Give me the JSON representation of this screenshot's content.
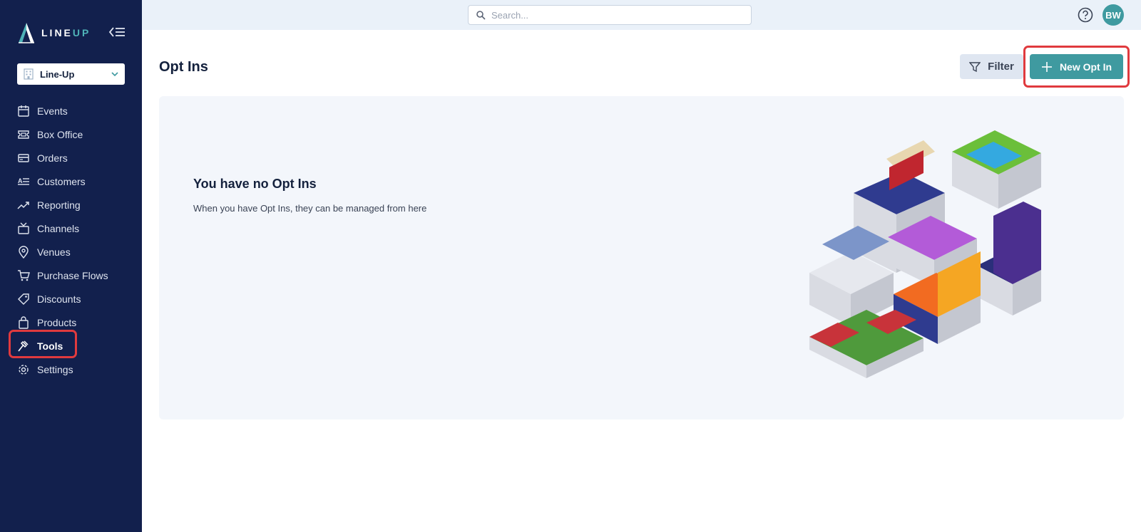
{
  "app": {
    "logo_line": "LINE",
    "logo_up": "UP"
  },
  "org_select": {
    "value": "Line-Up"
  },
  "nav": {
    "items": [
      {
        "label": "Events",
        "icon": "calendar-icon"
      },
      {
        "label": "Box Office",
        "icon": "ticket-icon"
      },
      {
        "label": "Orders",
        "icon": "credit-card-icon"
      },
      {
        "label": "Customers",
        "icon": "contact-list-icon"
      },
      {
        "label": "Reporting",
        "icon": "trend-up-icon"
      },
      {
        "label": "Channels",
        "icon": "tv-icon"
      },
      {
        "label": "Venues",
        "icon": "map-pin-icon"
      },
      {
        "label": "Purchase Flows",
        "icon": "cart-icon"
      },
      {
        "label": "Discounts",
        "icon": "tag-icon"
      },
      {
        "label": "Products",
        "icon": "shopping-bag-icon"
      },
      {
        "label": "Tools",
        "icon": "hammer-icon",
        "active": true
      },
      {
        "label": "Settings",
        "icon": "gear-icon"
      }
    ]
  },
  "topbar": {
    "search_placeholder": "Search...",
    "avatar_initials": "BW"
  },
  "main": {
    "title": "Opt Ins",
    "filter_label": "Filter",
    "new_label": "New Opt In",
    "empty_title": "You have no Opt Ins",
    "empty_desc": "When you have Opt Ins, they can be managed from here"
  },
  "colors": {
    "sidebar_bg": "#12204d",
    "accent": "#3f9aa0",
    "highlight": "#e03a3e",
    "topbar_bg": "#eaf1f9",
    "card_bg": "#f3f6fb"
  }
}
